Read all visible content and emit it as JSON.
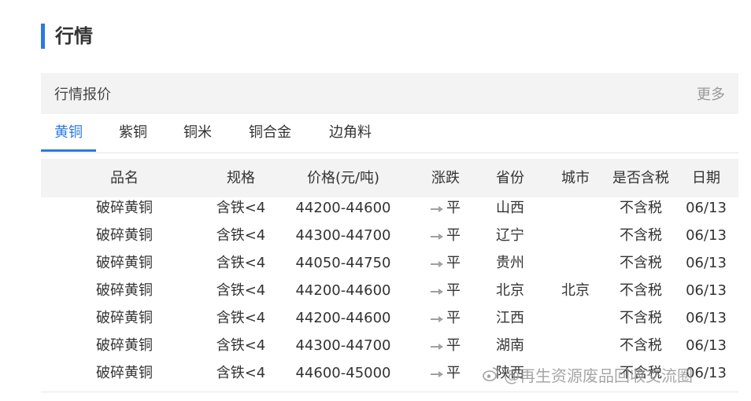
{
  "page": {
    "title": "行情"
  },
  "subheader": {
    "title": "行情报价",
    "more": "更多"
  },
  "tabs": [
    "黄铜",
    "紫铜",
    "铜米",
    "铜合金",
    "边角料"
  ],
  "table": {
    "headers": [
      "品名",
      "规格",
      "价格(元/吨)",
      "涨跌",
      "省份",
      "城市",
      "是否含税",
      "日期"
    ],
    "rows": [
      [
        "破碎黄铜",
        "含铁<4",
        "44200-44600",
        "平",
        "山西",
        "",
        "不含税",
        "06/13"
      ],
      [
        "破碎黄铜",
        "含铁<4",
        "44300-44700",
        "平",
        "辽宁",
        "",
        "不含税",
        "06/13"
      ],
      [
        "破碎黄铜",
        "含铁<4",
        "44050-44750",
        "平",
        "贵州",
        "",
        "不含税",
        "06/13"
      ],
      [
        "破碎黄铜",
        "含铁<4",
        "44200-44600",
        "平",
        "北京",
        "北京",
        "不含税",
        "06/13"
      ],
      [
        "破碎黄铜",
        "含铁<4",
        "44200-44600",
        "平",
        "江西",
        "",
        "不含税",
        "06/13"
      ],
      [
        "破碎黄铜",
        "含铁<4",
        "44300-44700",
        "平",
        "湖南",
        "",
        "不含税",
        "06/13"
      ],
      [
        "破碎黄铜",
        "含铁<4",
        "44600-45000",
        "平",
        "陕西",
        "",
        "不含税",
        "06/13"
      ]
    ],
    "trend_icon": "flat-arrow-icon"
  },
  "watermark": {
    "text": "@再生资源废品回收交流圈",
    "icon": "weibo-logo-icon"
  },
  "colors": {
    "accent": "#2a7ae2",
    "header_bg": "#f3f3f4",
    "muted": "#999999",
    "arrow": "#a0a0a0"
  }
}
